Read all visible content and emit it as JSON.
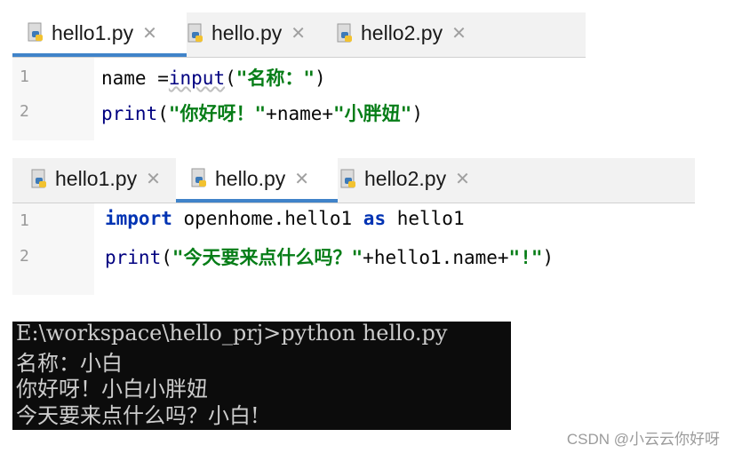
{
  "editor1": {
    "tabs": [
      {
        "label": "hello1.py",
        "active": true
      },
      {
        "label": "hello.py",
        "active": false
      },
      {
        "label": "hello2.py",
        "active": false
      }
    ],
    "line_numbers": [
      "1",
      "2"
    ],
    "line1": {
      "ident": "name ",
      "op": "=",
      "call": "input",
      "p1": "(",
      "str": "\"名称：\"",
      "p2": ")"
    },
    "line2": {
      "call": "print",
      "p1": "(",
      "str1": "\"你好呀！\"",
      "mid": "+name+",
      "str2": "\"小胖妞\"",
      "p2": ")"
    }
  },
  "editor2": {
    "tabs": [
      {
        "label": "hello1.py",
        "active": false
      },
      {
        "label": "hello.py",
        "active": true
      },
      {
        "label": "hello2.py",
        "active": false
      }
    ],
    "line_numbers": [
      "1",
      "2"
    ],
    "line1": {
      "kw1": "import",
      "mod": " openhome.hello1 ",
      "kw2": "as",
      "alias": " hello1"
    },
    "line2": {
      "call": "print",
      "p1": "(",
      "str1": "\"今天要来点什么吗？\"",
      "mid": "+hello1.name+",
      "str2": "\"!\"",
      "p2": ")"
    }
  },
  "console": {
    "lines": [
      "E:\\workspace\\hello_prj>python hello.py",
      "名称：小白",
      "你好呀！小白小胖妞",
      "今天要来点什么吗？小白!"
    ]
  },
  "watermark": "CSDN @小云云你好呀",
  "colors": {
    "tab_underline": "#4083c9",
    "keyword": "#0033b3",
    "string": "#067d17",
    "console_bg": "#0c0c0c"
  },
  "icons": {
    "tab_file": "python-file-icon",
    "tab_close": "close-icon"
  }
}
